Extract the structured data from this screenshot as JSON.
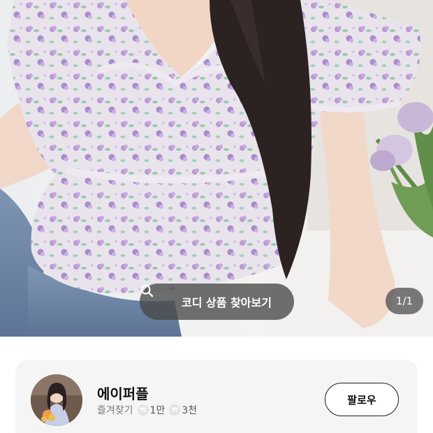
{
  "photo": {
    "find_button_label": "코디 상품 찾아보기",
    "search_icon": "search-icon",
    "page_indicator": "1/1"
  },
  "shop": {
    "name": "에이퍼플",
    "favorite_label": "즐겨찾기",
    "likes": "1만",
    "items": "3천",
    "follow_label": "팔로우",
    "coin_icon": "coin-icon"
  },
  "colors": {
    "overlay": "#484848",
    "card_background": "#f5f5f5",
    "follow_border": "#1a1a1a"
  }
}
